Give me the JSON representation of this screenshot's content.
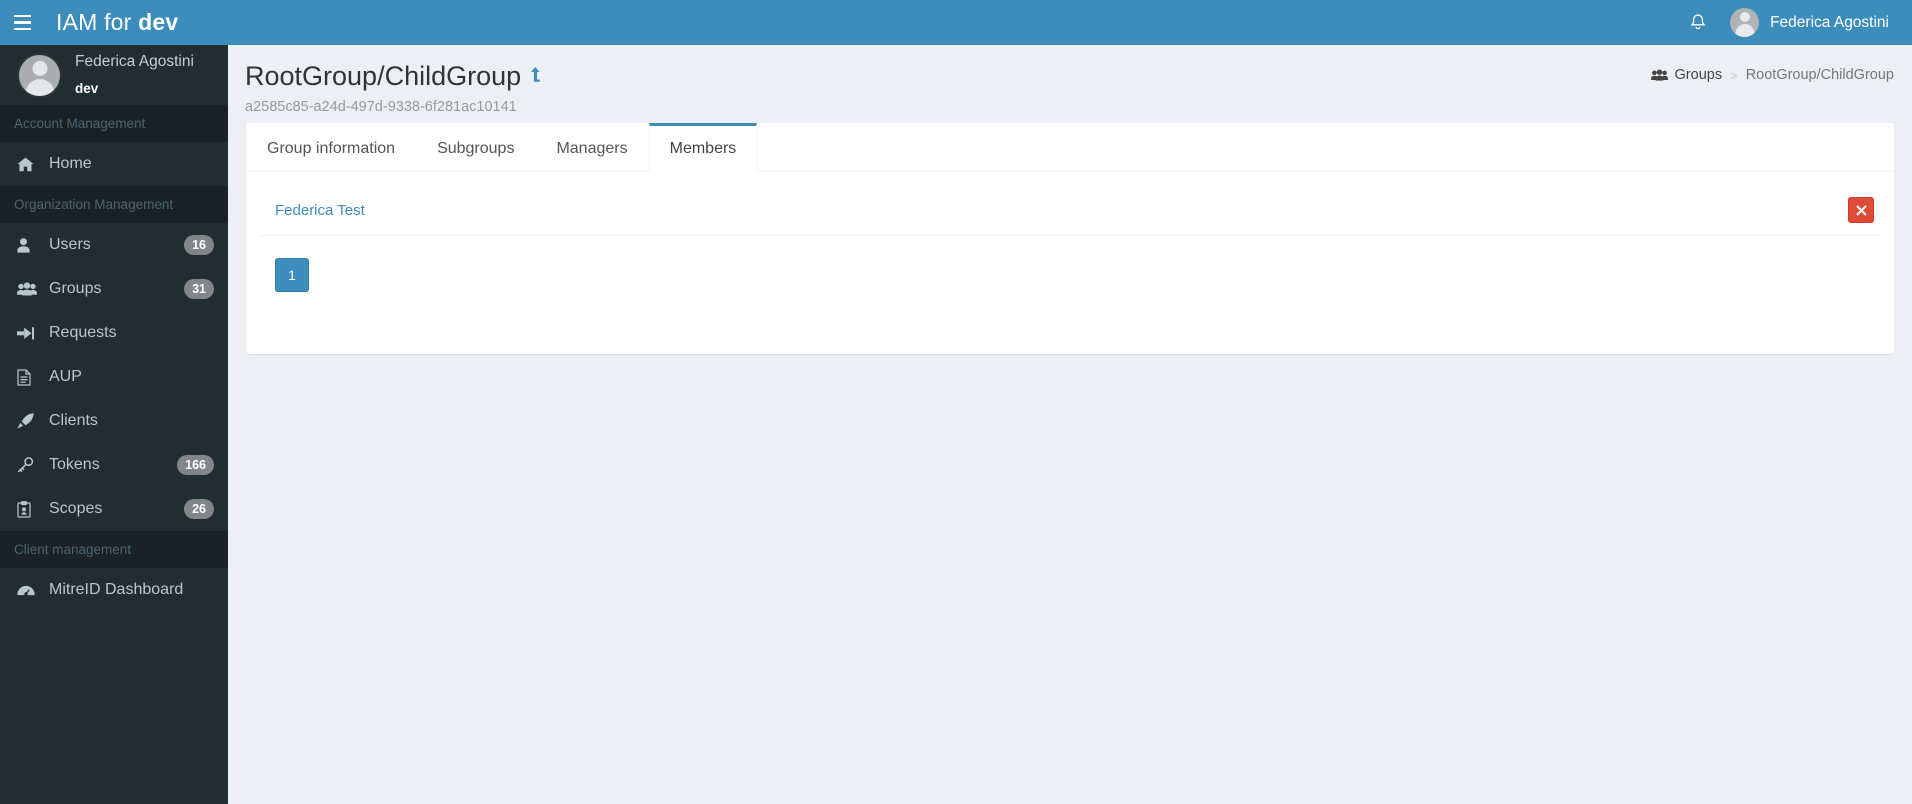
{
  "navbar": {
    "menu_toggle": "menu-toggle",
    "brand_prefix": "IAM for ",
    "brand_suffix": "dev",
    "notification_icon": "bell-icon",
    "username": "Federica Agostini",
    "bg_color": "#3c8dbc"
  },
  "sidebar": {
    "bg_color": "#222d32",
    "user_panel": {
      "name": "Federica Agostini",
      "realm": "dev"
    },
    "sections": [
      {
        "header": "Account Management",
        "items": [
          {
            "label": "Home",
            "icon": "home-icon",
            "badge": null,
            "active": true
          }
        ]
      },
      {
        "header": "Organization Management",
        "items": [
          {
            "label": "Users",
            "icon": "user-icon",
            "badge": "16"
          },
          {
            "label": "Groups",
            "icon": "users-icon",
            "badge": "31"
          },
          {
            "label": "Requests",
            "icon": "sign-in-icon",
            "badge": null
          },
          {
            "label": "AUP",
            "icon": "file-text-icon",
            "badge": null
          },
          {
            "label": "Clients",
            "icon": "rocket-icon",
            "badge": null
          },
          {
            "label": "Tokens",
            "icon": "key-icon",
            "badge": "166"
          },
          {
            "label": "Scopes",
            "icon": "clipboard-icon",
            "badge": "26"
          }
        ]
      },
      {
        "header": "Client management",
        "items": [
          {
            "label": "MitreID Dashboard",
            "icon": "dashboard-icon",
            "badge": null
          }
        ]
      }
    ]
  },
  "content_header": {
    "title": "RootGroup/ChildGroup",
    "title_action_icon": "level-up-icon",
    "subtitle": "a2585c85-a24d-497d-9338-6f281ac10141"
  },
  "breadcrumb": {
    "icon": "users-icon",
    "root": "Groups",
    "separator": ">",
    "current": "RootGroup/ChildGroup"
  },
  "tabs": [
    {
      "label": "Group information",
      "active": false
    },
    {
      "label": "Subgroups",
      "active": false
    },
    {
      "label": "Managers",
      "active": false
    },
    {
      "label": "Members",
      "active": true
    }
  ],
  "members": {
    "rows": [
      {
        "name": "Federica Test",
        "remove_icon": "times-icon"
      }
    ]
  },
  "pagination": {
    "pages": [
      "1"
    ],
    "current": "1"
  },
  "colors": {
    "accent": "#3c8dbc",
    "danger": "#dd4b39",
    "sidebar": "#222d32",
    "body_bg": "#ecf0f5",
    "link": "#3c8dbc"
  }
}
